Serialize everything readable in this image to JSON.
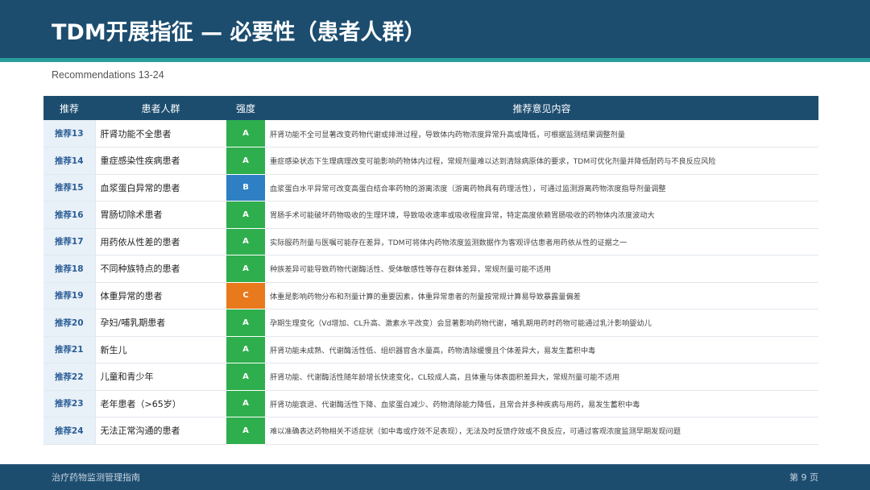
{
  "slide": {
    "title": "TDM开展指征 — 必要性（患者人群）",
    "subtitle": "Recommendations 13-24"
  },
  "colors": {
    "header": "#1c4d6f",
    "accent_line": "#2a9d9d",
    "grade_A": "#2fae4e",
    "grade_B": "#2f7fc4",
    "grade_C": "#e8791c"
  },
  "table": {
    "headers": [
      "推荐",
      "患者人群",
      "强度",
      "推荐意见内容"
    ],
    "rows": [
      {
        "id": "推荐13",
        "population": "肝肾功能不全患者",
        "grade": "A",
        "color": "#2fae4e",
        "text": "肝肾功能不全可显著改变药物代谢或排泄过程，导致体内药物浓度异常升高或降低，可根据监测结果调整剂量"
      },
      {
        "id": "推荐14",
        "population": "重症感染性疾病患者",
        "grade": "A",
        "color": "#2fae4e",
        "text": "重症感染状态下生理病理改变可能影响药物体内过程，常规剂量难以达到清除病原体的要求，TDM可优化剂量并降低耐药与不良反应风险"
      },
      {
        "id": "推荐15",
        "population": "血浆蛋白异常的患者",
        "grade": "B",
        "color": "#2f7fc4",
        "text": "血浆蛋白水平异常可改变高蛋白结合率药物的游离浓度（游离药物具有药理活性），可通过监测游离药物浓度指导剂量调整"
      },
      {
        "id": "推荐16",
        "population": "胃肠切除术患者",
        "grade": "A",
        "color": "#2fae4e",
        "text": "胃肠手术可能破坏药物吸收的生理环境，导致吸收速率或吸收程度异常，特定高度依赖胃肠吸收的药物体内浓度波动大"
      },
      {
        "id": "推荐17",
        "population": "用药依从性差的患者",
        "grade": "A",
        "color": "#2fae4e",
        "text": "实际服药剂量与医嘱可能存在差异，TDM可将体内药物浓度监测数据作为客观评估患者用药依从性的证据之一"
      },
      {
        "id": "推荐18",
        "population": "不同种族特点的患者",
        "grade": "A",
        "color": "#2fae4e",
        "text": "种族差异可能导致药物代谢酶活性、受体敏感性等存在群体差异，常规剂量可能不适用"
      },
      {
        "id": "推荐19",
        "population": "体重异常的患者",
        "grade": "C",
        "color": "#e8791c",
        "text": "体重是影响药物分布和剂量计算的重要因素，体重异常患者的剂量按常规计算易导致暴露量偏差"
      },
      {
        "id": "推荐20",
        "population": "孕妇/哺乳期患者",
        "grade": "A",
        "color": "#2fae4e",
        "text": "孕期生理变化（Vd增加、CL升高、激素水平改变）会显著影响药物代谢，哺乳期用药时药物可能通过乳汁影响婴幼儿"
      },
      {
        "id": "推荐21",
        "population": "新生儿",
        "grade": "A",
        "color": "#2fae4e",
        "text": "肝肾功能未成熟、代谢酶活性低、组织器官含水量高，药物清除缓慢且个体差异大，易发生蓄积中毒"
      },
      {
        "id": "推荐22",
        "population": "儿童和青少年",
        "grade": "A",
        "color": "#2fae4e",
        "text": "肝肾功能、代谢酶活性随年龄增长快速变化，CL较成人高，且体重与体表面积差异大，常规剂量可能不适用"
      },
      {
        "id": "推荐23",
        "population": "老年患者（>65岁）",
        "grade": "A",
        "color": "#2fae4e",
        "text": "肝肾功能衰退、代谢酶活性下降、血浆蛋白减少、药物清除能力降低，且常合并多种疾病与用药，易发生蓄积中毒"
      },
      {
        "id": "推荐24",
        "population": "无法正常沟通的患者",
        "grade": "A",
        "color": "#2fae4e",
        "text": "难以准确表达药物相关不适症状（如中毒或疗效不足表现），无法及时反馈疗效或不良反应，可通过客观浓度监测早期发现问题"
      }
    ]
  },
  "footer": {
    "left": "治疗药物监测管理指南",
    "right": "第 9 页"
  }
}
